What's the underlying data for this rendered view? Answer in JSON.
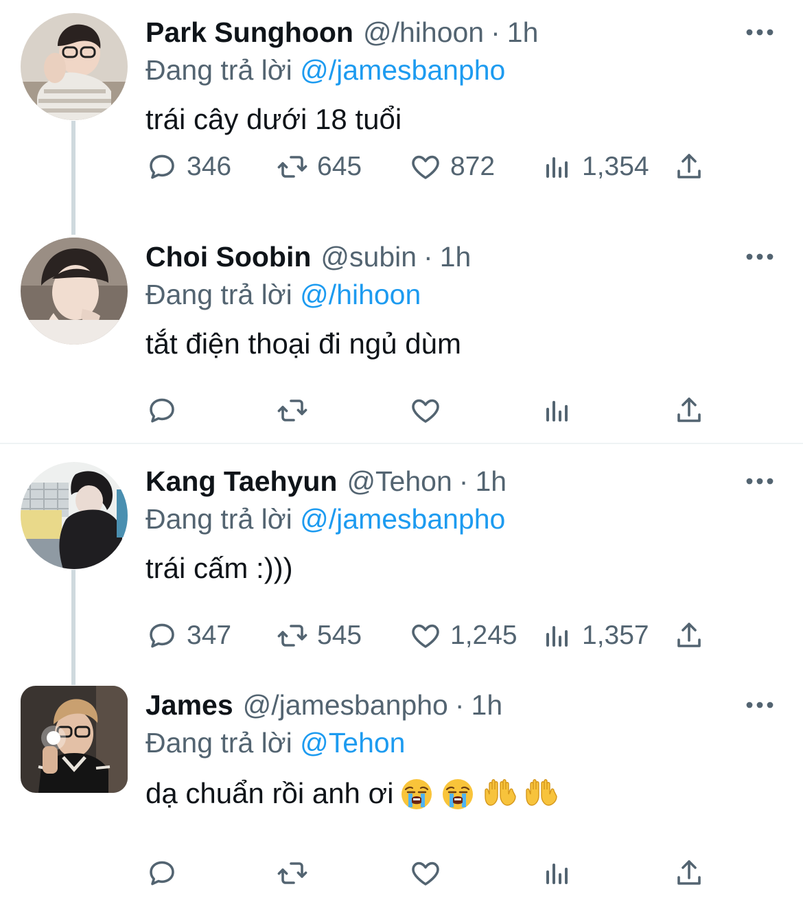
{
  "reply_prefix": "Đang trả lời",
  "colors": {
    "text": "#0f1419",
    "muted": "#536471",
    "link": "#1d9bf0",
    "thread_line": "#cfd9de",
    "divider": "#eff3f4"
  },
  "tweets": [
    {
      "name": "Park Sunghoon",
      "handle": "@/hihoon",
      "separator": "·",
      "time": "1h",
      "reply_to": "@/jamesbanpho",
      "text": "trái cây dưới 18 tuổi",
      "replies": "346",
      "retweets": "645",
      "likes": "872",
      "views": "1,354",
      "avatar": "profile-photo-park-sunghoon"
    },
    {
      "name": "Choi Soobin",
      "handle": "@subin",
      "separator": "·",
      "time": "1h",
      "reply_to": "@/hihoon",
      "text": "tắt điện thoại đi ngủ dùm",
      "replies": "",
      "retweets": "",
      "likes": "",
      "views": "",
      "avatar": "profile-photo-choi-soobin"
    },
    {
      "name": "Kang Taehyun",
      "handle": "@Tehon",
      "separator": "·",
      "time": "1h",
      "reply_to": "@/jamesbanpho",
      "text": "trái cấm :)))",
      "replies": "347",
      "retweets": "545",
      "likes": "1,245",
      "views": "1,357",
      "avatar": "profile-photo-kang-taehyun"
    },
    {
      "name": "James",
      "handle": "@/jamesbanpho",
      "separator": "·",
      "time": "1h",
      "reply_to": "@Tehon",
      "text": "dạ chuẩn rồi anh ơi",
      "emojis": [
        "loudly-crying-face",
        "loudly-crying-face",
        "raising-hands",
        "raising-hands"
      ],
      "replies": "",
      "retweets": "",
      "likes": "",
      "views": "",
      "avatar": "profile-photo-james"
    }
  ]
}
